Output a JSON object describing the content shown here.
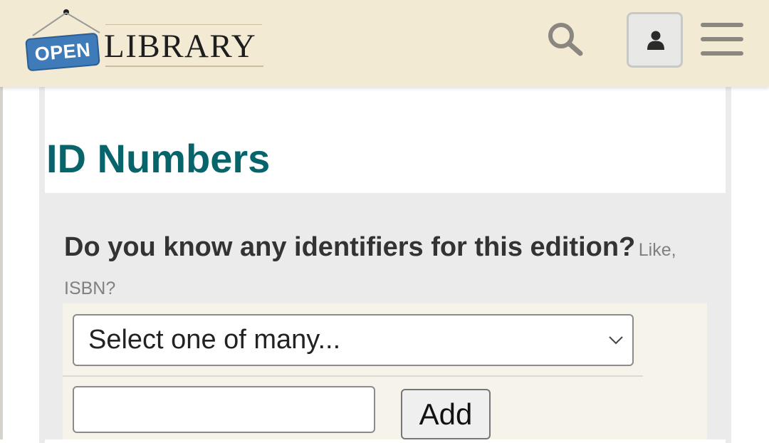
{
  "header": {
    "logo": {
      "open_text": "OPEN",
      "library_text": "LIBRARY"
    },
    "search_icon": "search-icon",
    "account_icon": "user-icon",
    "menu_icon": "hamburger-menu-icon"
  },
  "main": {
    "title": "ID Numbers",
    "question": "Do you know any identifiers for this edition?",
    "question_hint": "Like, ISBN?",
    "identifier_select": {
      "selected": "Select one of many...",
      "icon": "chevron-down-icon"
    },
    "identifier_input": {
      "value": "",
      "placeholder": ""
    },
    "add_button_label": "Add"
  },
  "colors": {
    "header_bg": "#f3ead4",
    "title": "#07646b",
    "logo_blue": "#3f7ab9",
    "section_bg": "#ebebeb",
    "form_bg": "#f5f3ea"
  }
}
